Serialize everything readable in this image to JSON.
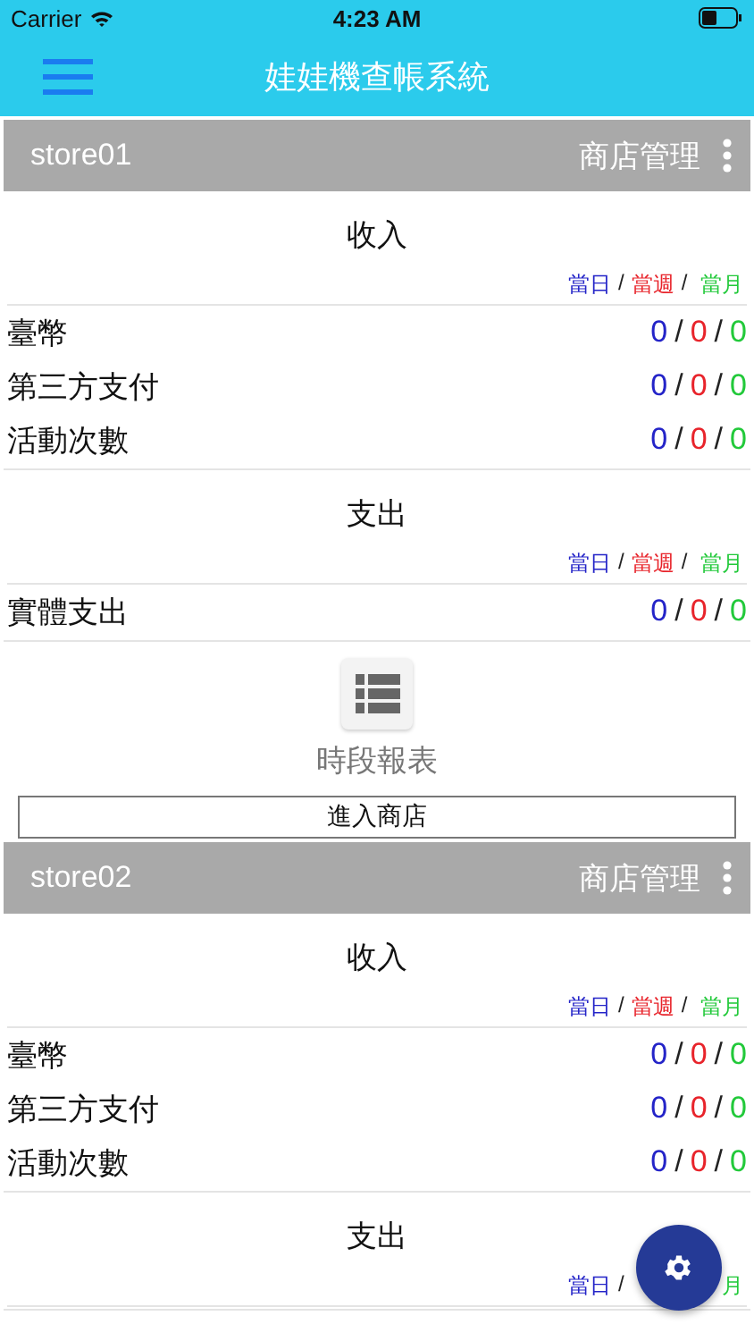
{
  "status_bar": {
    "carrier": "Carrier",
    "time": "4:23 AM"
  },
  "app_bar": {
    "title": "娃娃機查帳系統"
  },
  "stores": [
    {
      "name": "store01",
      "manage": "商店管理",
      "sections": [
        {
          "title": "收入",
          "legend": [
            {
              "text": "當日",
              "color": "#2424c8"
            },
            {
              "text": "/"
            },
            {
              "text": "當週",
              "color": "#e8242b"
            },
            {
              "text": "/"
            },
            {
              "text": "當月",
              "color": "#22c93a"
            }
          ],
          "rows": [
            {
              "label": "臺幣",
              "values": [
                {
                  "text": "0",
                  "color": "#2424c8"
                },
                {
                  "text": "/"
                },
                {
                  "text": "0",
                  "color": "#e8242b"
                },
                {
                  "text": "/"
                },
                {
                  "text": "0",
                  "color": "#22c93a"
                }
              ]
            },
            {
              "label": "第三方支付",
              "values": [
                {
                  "text": "0",
                  "color": "#2424c8"
                },
                {
                  "text": "/"
                },
                {
                  "text": "0",
                  "color": "#e8242b"
                },
                {
                  "text": "/"
                },
                {
                  "text": "0",
                  "color": "#22c93a"
                }
              ]
            },
            {
              "label": "活動次數",
              "values": [
                {
                  "text": "0",
                  "color": "#2424c8"
                },
                {
                  "text": "/"
                },
                {
                  "text": "0",
                  "color": "#e8242b"
                },
                {
                  "text": "/"
                },
                {
                  "text": "0",
                  "color": "#22c93a"
                }
              ]
            }
          ]
        },
        {
          "title": "支出",
          "legend": [
            {
              "text": "當日",
              "color": "#2424c8"
            },
            {
              "text": "/"
            },
            {
              "text": "當週",
              "color": "#e8242b"
            },
            {
              "text": "/"
            },
            {
              "text": "當月",
              "color": "#22c93a"
            }
          ],
          "rows": [
            {
              "label": "實體支出",
              "values": [
                {
                  "text": "0",
                  "color": "#2424c8"
                },
                {
                  "text": "/"
                },
                {
                  "text": "0",
                  "color": "#e8242b"
                },
                {
                  "text": "/"
                },
                {
                  "text": "0",
                  "color": "#22c93a"
                }
              ]
            }
          ]
        }
      ],
      "report": "時段報表",
      "enter_button": "進入商店"
    },
    {
      "name": "store02",
      "manage": "商店管理",
      "sections": [
        {
          "title": "收入",
          "legend": [
            {
              "text": "當日",
              "color": "#2424c8"
            },
            {
              "text": "/"
            },
            {
              "text": "當週",
              "color": "#e8242b"
            },
            {
              "text": "/"
            },
            {
              "text": "當月",
              "color": "#22c93a"
            }
          ],
          "rows": [
            {
              "label": "臺幣",
              "values": [
                {
                  "text": "0",
                  "color": "#2424c8"
                },
                {
                  "text": "/"
                },
                {
                  "text": "0",
                  "color": "#e8242b"
                },
                {
                  "text": "/"
                },
                {
                  "text": "0",
                  "color": "#22c93a"
                }
              ]
            },
            {
              "label": "第三方支付",
              "values": [
                {
                  "text": "0",
                  "color": "#2424c8"
                },
                {
                  "text": "/"
                },
                {
                  "text": "0",
                  "color": "#e8242b"
                },
                {
                  "text": "/"
                },
                {
                  "text": "0",
                  "color": "#22c93a"
                }
              ]
            },
            {
              "label": "活動次數",
              "values": [
                {
                  "text": "0",
                  "color": "#2424c8"
                },
                {
                  "text": "/"
                },
                {
                  "text": "0",
                  "color": "#e8242b"
                },
                {
                  "text": "/"
                },
                {
                  "text": "0",
                  "color": "#22c93a"
                }
              ]
            }
          ]
        },
        {
          "title": "支出",
          "legend": [
            {
              "text": "當日",
              "color": "#2424c8"
            },
            {
              "text": "/"
            },
            {
              "text": "月",
              "color": "#22c93a"
            }
          ]
        }
      ]
    }
  ]
}
